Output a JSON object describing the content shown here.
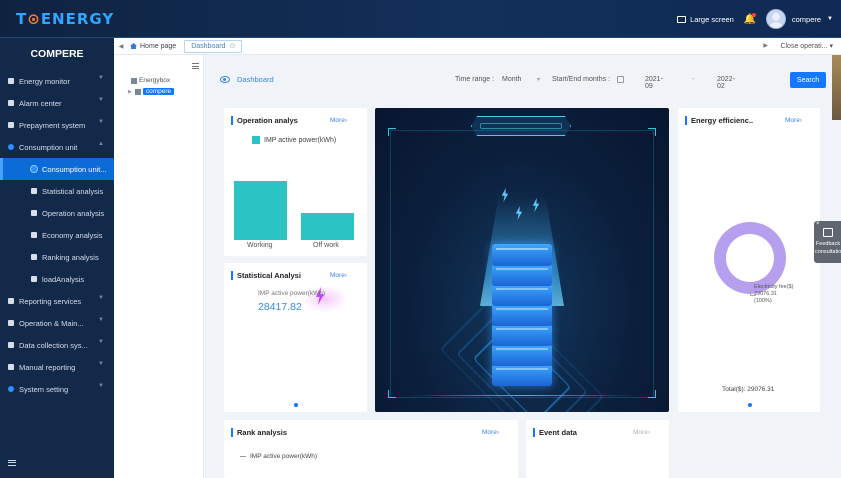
{
  "app": {
    "logo": "TOENERGY",
    "large_screen": "Large screen",
    "username": "compere"
  },
  "sidebar": {
    "title": "COMPERE",
    "items": [
      {
        "label": "Energy monitor"
      },
      {
        "label": "Alarm center"
      },
      {
        "label": "Prepayment system"
      },
      {
        "label": "Consumption unit"
      },
      {
        "label": "Consumption unit..."
      },
      {
        "label": "Statistical analysis"
      },
      {
        "label": "Operation analysis"
      },
      {
        "label": "Economy analysis"
      },
      {
        "label": "Ranking analysis"
      },
      {
        "label": "loadAnalysis"
      },
      {
        "label": "Reporting services"
      },
      {
        "label": "Operation & Main..."
      },
      {
        "label": "Data collection sys..."
      },
      {
        "label": "Manual reporting"
      },
      {
        "label": "System setting"
      }
    ]
  },
  "tabs": {
    "home": "Home page",
    "dashboard": "Dashboard",
    "close_ops": "Close operati..."
  },
  "tree": {
    "root": "Energybox",
    "child": "compere"
  },
  "breadcrumb": "Dashboard",
  "filters": {
    "time_range_label": "Time range :",
    "time_range_value": "Month",
    "months_label": "Start/End months :",
    "start": "2021-09",
    "dash": "-",
    "end": "2022-02",
    "search": "Search"
  },
  "cards": {
    "operation": {
      "title": "Operation analys",
      "more": "More",
      "legend": "IMP active power(kWh)",
      "bars": [
        {
          "label": "Working"
        },
        {
          "label": "Off work"
        }
      ]
    },
    "statistical": {
      "title": "Statistical Analysi",
      "more": "More",
      "label": "IMP active power(kWh)",
      "value": "28417.82"
    },
    "efficiency": {
      "title": "Energy efficienc..",
      "more": "More",
      "slice_label": "Electricity fee($)",
      "slice_value": "29076.31",
      "slice_pct": "(100%)",
      "total_label": "Total($):",
      "total_value": "29076.31"
    },
    "rank": {
      "title": "Rank analysis",
      "more": "More",
      "legend": "IMP active power(kWh)"
    },
    "event": {
      "title": "Event data",
      "more": "More"
    }
  },
  "feedback": {
    "line1": "Feedback",
    "line2": "consultation"
  },
  "colors": {
    "primary": "#1677ff",
    "sidebar": "#13294a",
    "bar": "#2bc4c4",
    "donut": "#b79ff0"
  },
  "chart_data": {
    "type": "bar",
    "categories": [
      "Working",
      "Off work"
    ],
    "series": [
      {
        "name": "IMP active power(kWh)",
        "values": [
          20500,
          9500
        ]
      }
    ],
    "ylim": [
      0,
      25000
    ]
  }
}
